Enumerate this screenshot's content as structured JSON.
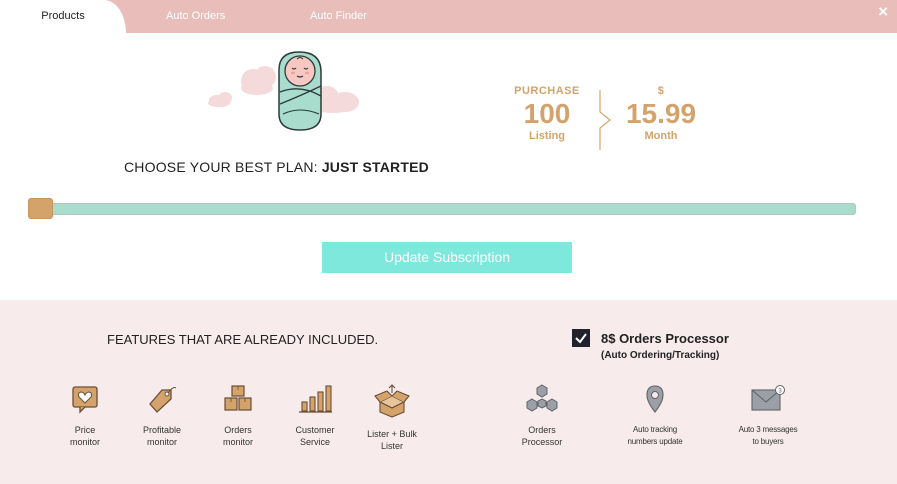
{
  "tabs": [
    {
      "label": "Products"
    },
    {
      "label": "Auto Orders"
    },
    {
      "label": "Auto Finder"
    }
  ],
  "close_icon": "close-icon",
  "plan": {
    "prefix": "CHOOSE YOUR BEST PLAN: ",
    "name": "JUST STARTED"
  },
  "price": {
    "left_caption": "PURCHASE",
    "left_value": "100",
    "left_unit": "Listing",
    "right_caption": "$",
    "right_value": "15.99",
    "right_unit": "Month"
  },
  "slider": {
    "level": 0
  },
  "update_button": "Update Subscription",
  "features": {
    "title": "FEATURES THAT ARE ALREADY INCLUDED.",
    "items": [
      {
        "line1": "Price",
        "line2": "monitor",
        "icon": "heart-chat-icon"
      },
      {
        "line1": "Profitable",
        "line2": "monitor",
        "icon": "price-tag-icon"
      },
      {
        "line1": "Orders",
        "line2": "monitor",
        "icon": "boxes-icon"
      },
      {
        "line1": "Customer",
        "line2": "Service",
        "icon": "bar-chart-icon"
      },
      {
        "line1": "Lister + Bulk",
        "line2": "Lister",
        "icon": "open-box-icon"
      }
    ]
  },
  "orders_processor": {
    "checked": true,
    "title": "8$ Orders Processor",
    "subtitle": "(Auto Ordering/Tracking)",
    "items": [
      {
        "line1": "Orders",
        "line2": "Processor",
        "icon": "cubes-network-icon"
      },
      {
        "line1": "Auto tracking",
        "line2": "numbers update",
        "icon": "map-pin-icon"
      },
      {
        "line1": "Auto 3 messages",
        "line2": "to buyers",
        "icon": "envelope-icon"
      }
    ]
  },
  "colors": {
    "tab_bar": "#e8bdba",
    "accent_tan": "#d4a36c",
    "track": "#a8dccc",
    "button": "#7fe8dc",
    "features_bg": "#f8ebeb"
  }
}
